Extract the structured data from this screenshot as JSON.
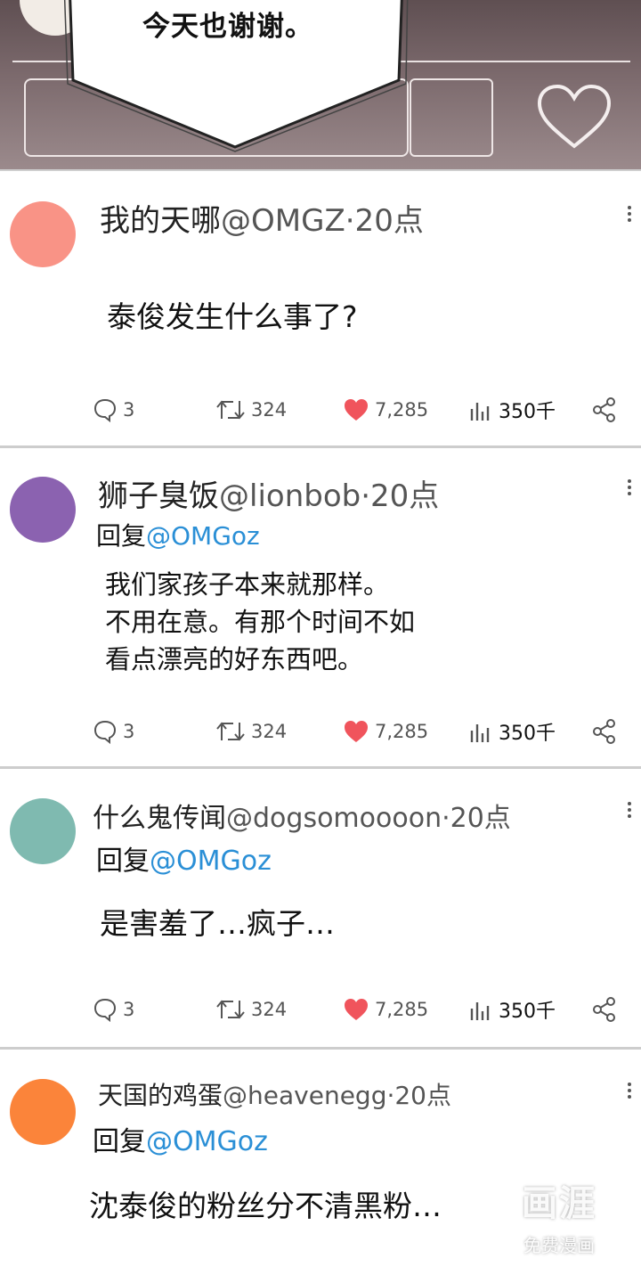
{
  "top_panel": {
    "speech_text": "今天也谢谢。"
  },
  "tweets": [
    {
      "name": "我的天哪",
      "handle": "@OMGZ",
      "time": "·20点",
      "reply_prefix": "",
      "reply_to": "",
      "body": "泰俊发生什么事了?",
      "comments": "3",
      "retweets": "324",
      "likes": "7,285",
      "views": "350千",
      "avatar_color": "#f99386"
    },
    {
      "name": "狮子臭饭",
      "handle": "@lionbob",
      "time": "·20点",
      "reply_prefix": "回复",
      "reply_to": "@OMGoz",
      "body": "我们家孩子本来就那样。\n不用在意。有那个时间不如\n看点漂亮的好东西吧。",
      "comments": "3",
      "retweets": "324",
      "likes": "7,285",
      "views": "350千",
      "avatar_color": "#8b62b0"
    },
    {
      "name": "什么鬼传闻",
      "handle": "@dogsomoooon",
      "time": "·20点",
      "reply_prefix": "回复",
      "reply_to": "@OMGoz",
      "body": "是害羞了…疯子…",
      "comments": "3",
      "retweets": "324",
      "likes": "7,285",
      "views": "350千",
      "avatar_color": "#7fbab0"
    },
    {
      "name": "天国的鸡蛋",
      "handle": "@heavenegg",
      "time": "·20点",
      "reply_prefix": "回复",
      "reply_to": "@OMGoz",
      "body": "沈泰俊的粉丝分不清黑粉…",
      "avatar_color": "#fb843a"
    }
  ],
  "watermark": {
    "logo": "画涯",
    "tagline": "免费漫画"
  },
  "colors": {
    "like_heart": "#f0545c",
    "mention": "#2a8fd6",
    "separator": "#cdcdcd"
  },
  "icons": [
    "comment-icon",
    "retweet-icon",
    "heart-icon",
    "views-icon",
    "share-icon",
    "more-icon"
  ]
}
